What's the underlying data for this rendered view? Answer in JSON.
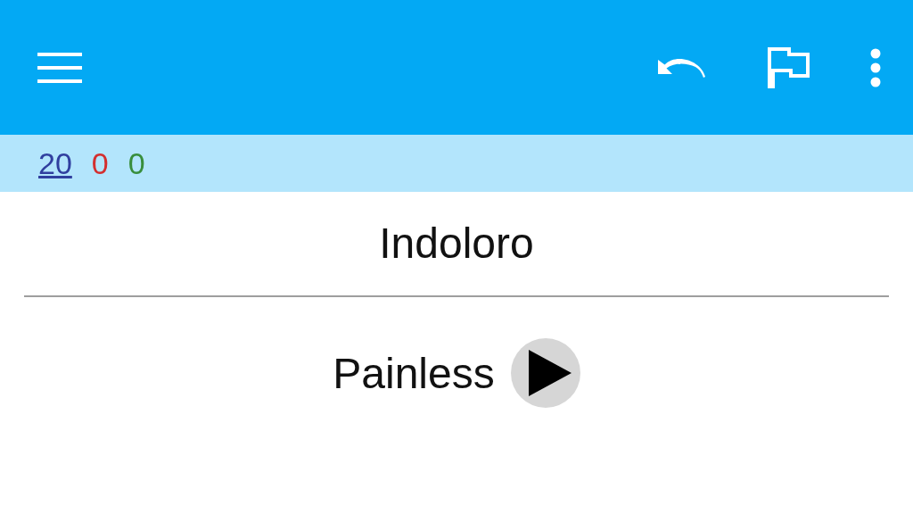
{
  "toolbar": {
    "actions": [
      {
        "kind": "undo"
      },
      {
        "kind": "flag"
      },
      {
        "kind": "more"
      }
    ]
  },
  "counts": [
    {
      "text": "20",
      "color": "#303f9f",
      "kind": "link"
    },
    {
      "text": "0",
      "color": "#d32f2f",
      "kind": "plain"
    },
    {
      "text": "0",
      "color": "#388e3c",
      "kind": "plain"
    }
  ],
  "question": {
    "word": "Indoloro"
  },
  "answer": {
    "text": "Painless",
    "audio": true
  }
}
